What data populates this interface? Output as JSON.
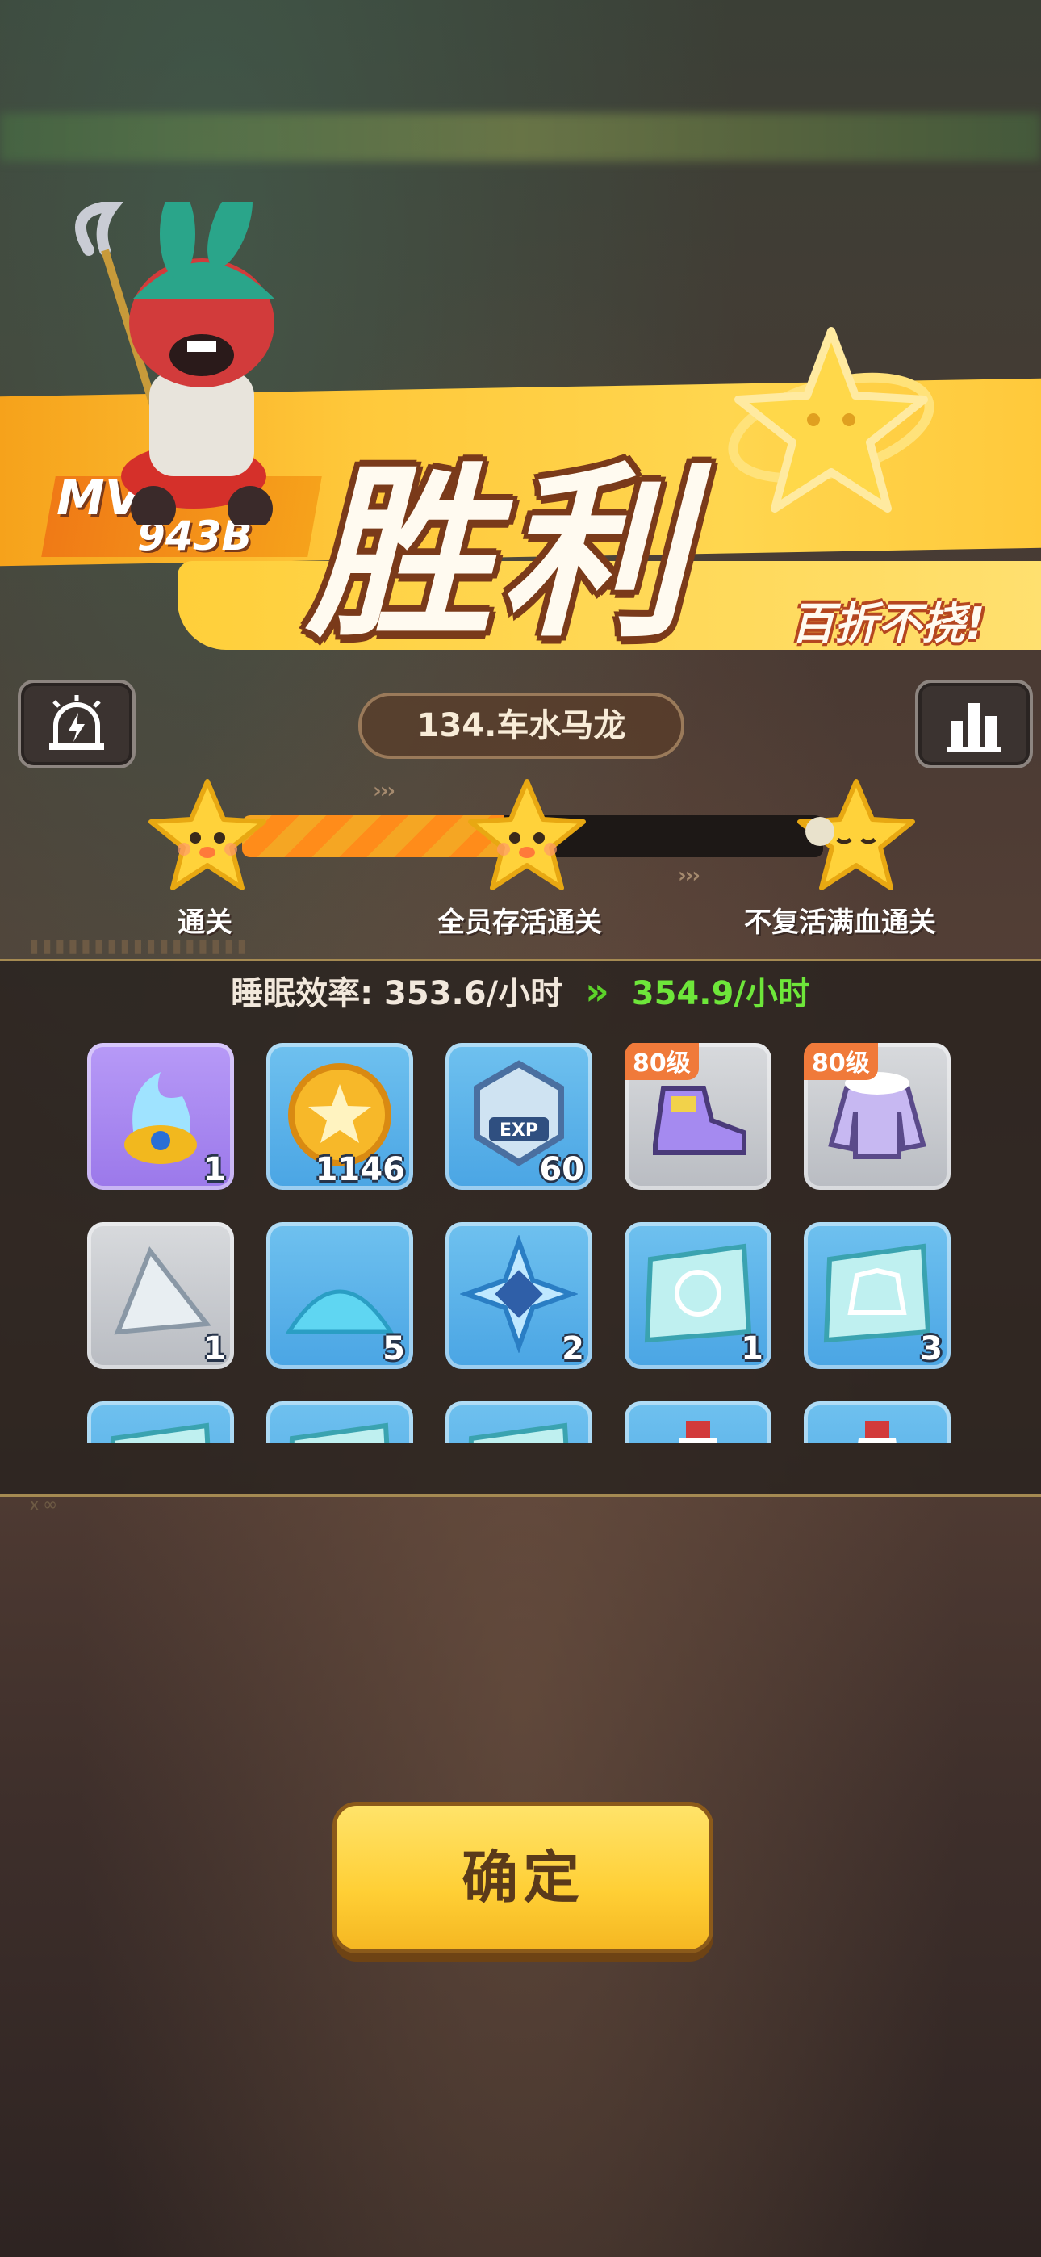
{
  "banner": {
    "title": "胜利",
    "slogan": "百折不挠!",
    "mvp_label": "MVP",
    "mvp_score": "943B"
  },
  "header": {
    "level_name": "134.车水马龙",
    "left_button_icon": "alarm-lightning-icon",
    "right_button_icon": "bar-chart-icon"
  },
  "progress": {
    "fill_fraction": 0.45,
    "stars": [
      {
        "label": "通关",
        "achieved": true
      },
      {
        "label": "全员存活通关",
        "achieved": true
      },
      {
        "label": "不复活满血通关",
        "achieved": false
      }
    ]
  },
  "sleep": {
    "label": "睡眠效率:",
    "old_value": "353.6/小时",
    "new_value": "354.9/小时"
  },
  "rewards": [
    {
      "icon": "blue-flame-pet-icon",
      "rarity": "purple",
      "qty": "1",
      "level": ""
    },
    {
      "icon": "gold-coin-icon",
      "rarity": "blue",
      "qty": "1146",
      "level": ""
    },
    {
      "icon": "exp-badge-icon",
      "rarity": "blue",
      "qty": "60",
      "level": ""
    },
    {
      "icon": "purple-shoe-icon",
      "rarity": "grey",
      "qty": "",
      "level": "80级"
    },
    {
      "icon": "winter-jacket-icon",
      "rarity": "grey",
      "qty": "",
      "level": "80级"
    },
    {
      "icon": "crystal-shard-icon",
      "rarity": "grey",
      "qty": "1",
      "level": ""
    },
    {
      "icon": "blue-sand-pile-icon",
      "rarity": "blue",
      "qty": "5",
      "level": ""
    },
    {
      "icon": "ice-crystal-icon",
      "rarity": "blue",
      "qty": "2",
      "level": ""
    },
    {
      "icon": "helmet-blueprint-icon",
      "rarity": "blue",
      "qty": "1",
      "level": ""
    },
    {
      "icon": "jacket-blueprint-icon",
      "rarity": "blue",
      "qty": "3",
      "level": ""
    },
    {
      "icon": "blueprint-icon",
      "rarity": "blue",
      "qty": "",
      "level": ""
    },
    {
      "icon": "blueprint-icon",
      "rarity": "blue",
      "qty": "",
      "level": ""
    },
    {
      "icon": "blueprint-icon",
      "rarity": "blue",
      "qty": "",
      "level": ""
    },
    {
      "icon": "potion-icon",
      "rarity": "blue",
      "qty": "",
      "level": ""
    },
    {
      "icon": "potion-icon",
      "rarity": "blue",
      "qty": "",
      "level": ""
    }
  ],
  "confirm_label": "确定",
  "colors": {
    "banner": "#ffc93b",
    "accent_green": "#6ee63a",
    "progress_fill": "#f5a623",
    "button": "#ffcf35"
  }
}
